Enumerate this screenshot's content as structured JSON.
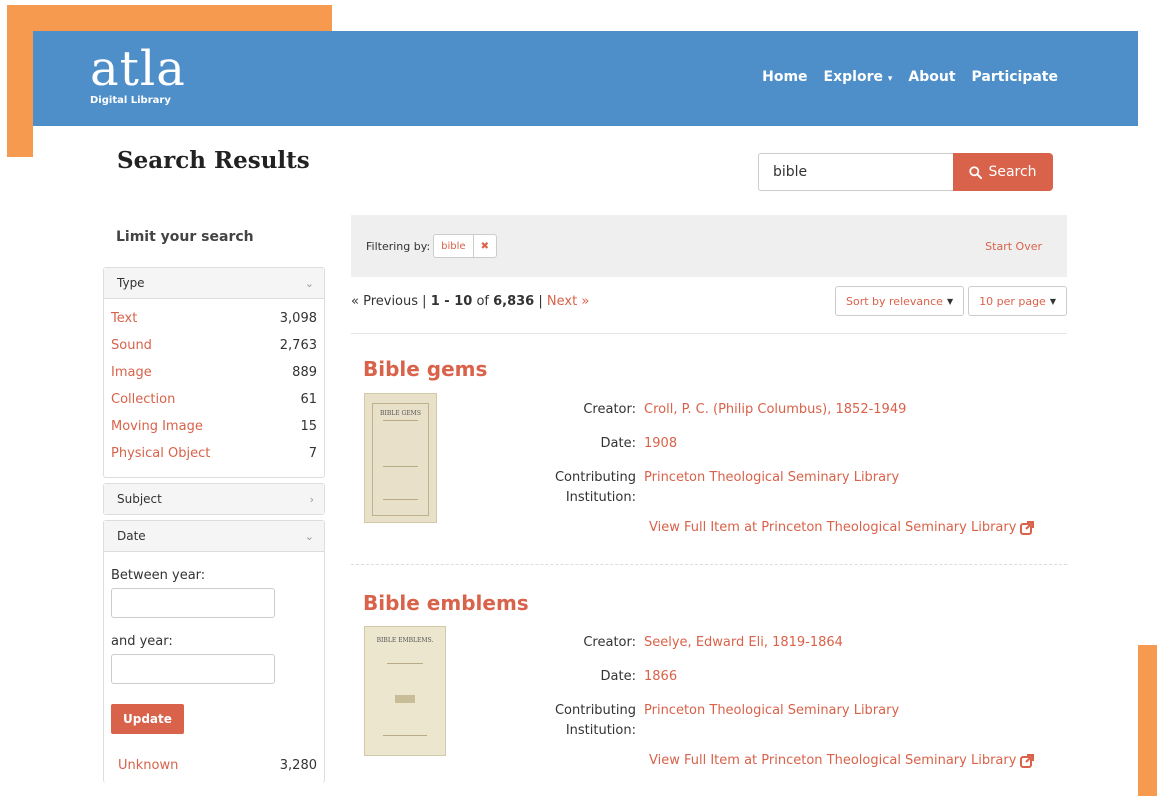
{
  "brand": {
    "logo_word": "atla",
    "logo_sub": "Digital Library"
  },
  "nav": {
    "items": [
      "Home",
      "Explore",
      "About",
      "Participate"
    ],
    "explore_caret": "▾"
  },
  "page_title": "Search Results",
  "search": {
    "value": "bible",
    "button_label": "Search"
  },
  "sidebar": {
    "title": "Limit your search",
    "type_facet": {
      "label": "Type",
      "items": [
        {
          "label": "Text",
          "count": "3,098"
        },
        {
          "label": "Sound",
          "count": "2,763"
        },
        {
          "label": "Image",
          "count": "889"
        },
        {
          "label": "Collection",
          "count": "61"
        },
        {
          "label": "Moving Image",
          "count": "15"
        },
        {
          "label": "Physical Object",
          "count": "7"
        }
      ]
    },
    "subject_facet": {
      "label": "Subject"
    },
    "date_facet": {
      "label": "Date",
      "between_label": "Between year:",
      "and_label": "and year:",
      "update_label": "Update"
    },
    "unknown": {
      "label": "Unknown",
      "count": "3,280"
    }
  },
  "filter": {
    "label": "Filtering by:",
    "chip": "bible",
    "remove": "✖",
    "start_over": "Start Over"
  },
  "pager": {
    "prev": "« Previous",
    "sep": "|",
    "range": "1 - 10",
    "of": "of",
    "total": "6,836",
    "next": "Next »"
  },
  "sort": {
    "sort_label": "Sort by relevance",
    "per_page_label": "10 per page"
  },
  "results": [
    {
      "title": "Bible gems",
      "thumb_title": "BIBLE GEMS",
      "creator_label": "Creator:",
      "creator": "Croll, P. C. (Philip Columbus), 1852-1949",
      "date_label": "Date:",
      "date": "1908",
      "contrib_label_1": "Contributing",
      "contrib_label_2": "Institution:",
      "institution": "Princeton Theological Seminary Library",
      "view_link": "View Full Item at Princeton Theological Seminary Library"
    },
    {
      "title": "Bible emblems",
      "thumb_title": "BIBLE EMBLEMS.",
      "creator_label": "Creator:",
      "creator": "Seelye, Edward Eli, 1819-1864",
      "date_label": "Date:",
      "date": "1866",
      "contrib_label_1": "Contributing",
      "contrib_label_2": "Institution:",
      "institution": "Princeton Theological Seminary Library",
      "view_link": "View Full Item at Princeton Theological Seminary Library"
    }
  ],
  "colors": {
    "accent": "#d9624a",
    "navbar": "#4e8fca",
    "decor": "#f59a4f"
  }
}
